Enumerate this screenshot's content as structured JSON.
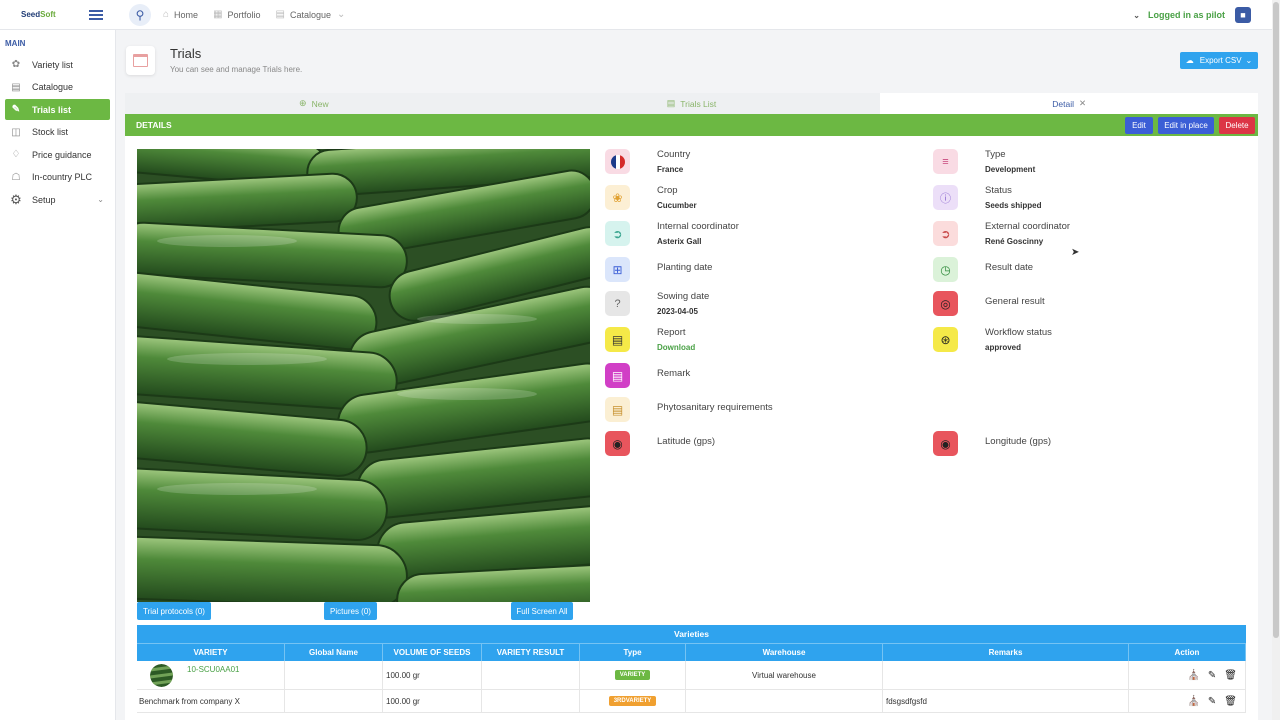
{
  "app": {
    "logo_main": "Seed",
    "logo_accent": "Soft"
  },
  "topbar": {
    "breadcrumbs": [
      {
        "label": "Home",
        "icon": "home-icon"
      },
      {
        "label": "Portfolio",
        "icon": "portfolio-icon"
      },
      {
        "label": "Catalogue",
        "icon": "catalogue-icon"
      }
    ],
    "logged_in": "Logged in as pilot"
  },
  "sidebar": {
    "section": "MAIN",
    "items": [
      {
        "label": "Variety list",
        "icon": "leaf-icon"
      },
      {
        "label": "Catalogue",
        "icon": "book-icon"
      },
      {
        "label": "Trials list",
        "icon": "edit-icon",
        "active": true
      },
      {
        "label": "Stock list",
        "icon": "database-icon"
      },
      {
        "label": "Price guidance",
        "icon": "tag-icon"
      },
      {
        "label": "In-country PLC",
        "icon": "bank-icon"
      },
      {
        "label": "Setup",
        "icon": "gear-icon"
      }
    ]
  },
  "header": {
    "title": "Trials",
    "subtitle": "You can see and manage Trials here.",
    "export_label": "Export CSV"
  },
  "tabs": [
    {
      "label": "New",
      "icon": "plus-circle-icon"
    },
    {
      "label": "Trials List",
      "icon": "list-icon"
    },
    {
      "label": "Detail",
      "active": true
    }
  ],
  "details": {
    "title": "DETAILS",
    "edit_label": "Edit",
    "edit_in_place_label": "Edit in place",
    "delete_label": "Delete",
    "fields": {
      "country": {
        "label": "Country",
        "value": "France"
      },
      "type": {
        "label": "Type",
        "value": "Development"
      },
      "crop": {
        "label": "Crop",
        "value": "Cucumber"
      },
      "status": {
        "label": "Status",
        "value": "Seeds shipped"
      },
      "internal_coordinator": {
        "label": "Internal coordinator",
        "value": "Asterix Gall"
      },
      "external_coordinator": {
        "label": "External coordinator",
        "value": "René Goscinny"
      },
      "planting_date": {
        "label": "Planting date",
        "value": ""
      },
      "result_date": {
        "label": "Result date",
        "value": ""
      },
      "sowing_date": {
        "label": "Sowing date",
        "value": "2023-04-05"
      },
      "general_result": {
        "label": "General result",
        "value": ""
      },
      "report": {
        "label": "Report",
        "value": "Download"
      },
      "workflow_status": {
        "label": "Workflow status",
        "value": "approved"
      },
      "remark": {
        "label": "Remark",
        "value": ""
      },
      "phytosanitary": {
        "label": "Phytosanitary requirements",
        "value": ""
      },
      "latitude": {
        "label": "Latitude (gps)",
        "value": ""
      },
      "longitude": {
        "label": "Longitude (gps)",
        "value": ""
      }
    },
    "buttons": {
      "trial_protocols": "Trial protocols (0)",
      "pictures": "Pictures (0)",
      "full_screen": "Full Screen All"
    }
  },
  "varieties": {
    "title": "Varieties",
    "columns": [
      "VARIETY",
      "Global Name",
      "VOLUME OF SEEDS",
      "VARIETY RESULT",
      "Type",
      "Warehouse",
      "Remarks",
      "Action"
    ],
    "rows": [
      {
        "variety": "10-SCU0AA01",
        "global_name": "",
        "volume": "100.00 gr",
        "result": "",
        "type": "VARIETY",
        "type_color": "#6cb843",
        "warehouse": "Virtual warehouse",
        "remarks": ""
      },
      {
        "variety": "Benchmark from company X",
        "global_name": "",
        "volume": "100.00 gr",
        "result": "",
        "type": "3RDVARIETY",
        "type_color": "#f0a030",
        "warehouse": "",
        "remarks": "fdsgsdfgsfd"
      }
    ]
  }
}
